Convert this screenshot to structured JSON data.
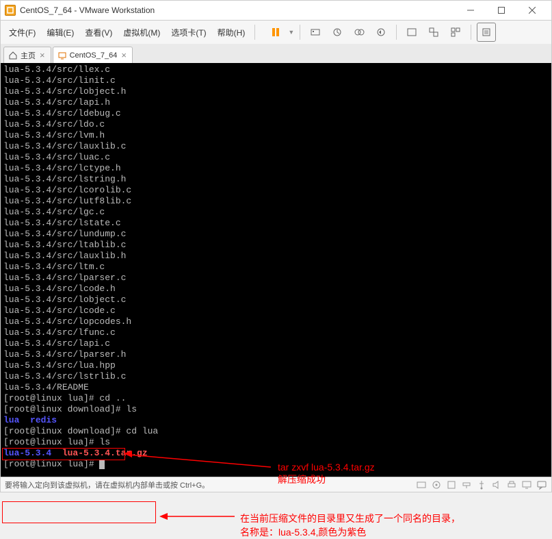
{
  "titlebar": {
    "title": "CentOS_7_64 - VMware Workstation"
  },
  "menubar": {
    "items": [
      "文件(F)",
      "编辑(E)",
      "查看(V)",
      "虚拟机(M)",
      "选项卡(T)",
      "帮助(H)"
    ]
  },
  "tabs": [
    {
      "label": "主页",
      "active": false
    },
    {
      "label": "CentOS_7_64",
      "active": true
    }
  ],
  "terminal": {
    "lines": [
      {
        "text": "lua-5.3.4/src/llex.c",
        "cls": "c-white"
      },
      {
        "text": "lua-5.3.4/src/linit.c",
        "cls": "c-white"
      },
      {
        "text": "lua-5.3.4/src/lobject.h",
        "cls": "c-white"
      },
      {
        "text": "lua-5.3.4/src/lapi.h",
        "cls": "c-white"
      },
      {
        "text": "lua-5.3.4/src/ldebug.c",
        "cls": "c-white"
      },
      {
        "text": "lua-5.3.4/src/ldo.c",
        "cls": "c-white"
      },
      {
        "text": "lua-5.3.4/src/lvm.h",
        "cls": "c-white"
      },
      {
        "text": "lua-5.3.4/src/lauxlib.c",
        "cls": "c-white"
      },
      {
        "text": "lua-5.3.4/src/luac.c",
        "cls": "c-white"
      },
      {
        "text": "lua-5.3.4/src/lctype.h",
        "cls": "c-white"
      },
      {
        "text": "lua-5.3.4/src/lstring.h",
        "cls": "c-white"
      },
      {
        "text": "lua-5.3.4/src/lcorolib.c",
        "cls": "c-white"
      },
      {
        "text": "lua-5.3.4/src/lutf8lib.c",
        "cls": "c-white"
      },
      {
        "text": "lua-5.3.4/src/lgc.c",
        "cls": "c-white"
      },
      {
        "text": "lua-5.3.4/src/lstate.c",
        "cls": "c-white"
      },
      {
        "text": "lua-5.3.4/src/lundump.c",
        "cls": "c-white"
      },
      {
        "text": "lua-5.3.4/src/ltablib.c",
        "cls": "c-white"
      },
      {
        "text": "lua-5.3.4/src/lauxlib.h",
        "cls": "c-white"
      },
      {
        "text": "lua-5.3.4/src/ltm.c",
        "cls": "c-white"
      },
      {
        "text": "lua-5.3.4/src/lparser.c",
        "cls": "c-white"
      },
      {
        "text": "lua-5.3.4/src/lcode.h",
        "cls": "c-white"
      },
      {
        "text": "lua-5.3.4/src/lobject.c",
        "cls": "c-white"
      },
      {
        "text": "lua-5.3.4/src/lcode.c",
        "cls": "c-white"
      },
      {
        "text": "lua-5.3.4/src/lopcodes.h",
        "cls": "c-white"
      },
      {
        "text": "lua-5.3.4/src/lfunc.c",
        "cls": "c-white"
      },
      {
        "text": "lua-5.3.4/src/lapi.c",
        "cls": "c-white"
      },
      {
        "text": "lua-5.3.4/src/lparser.h",
        "cls": "c-white"
      },
      {
        "text": "lua-5.3.4/src/lua.hpp",
        "cls": "c-white"
      },
      {
        "text": "lua-5.3.4/src/lstrlib.c",
        "cls": "c-white"
      },
      {
        "text": "lua-5.3.4/README",
        "cls": "c-white"
      }
    ],
    "prompt_lines": [
      {
        "prompt": "[root@linux lua]# ",
        "cmd": "cd .."
      },
      {
        "prompt": "[root@linux download]# ",
        "cmd": "ls"
      }
    ],
    "ls1": {
      "lua": "lua",
      "redis": "redis"
    },
    "prompt_cd": {
      "prompt": "[root@linux download]# ",
      "cmd": "cd lua"
    },
    "prompt_ls2": {
      "prompt": "[root@linux lua]# ",
      "cmd": "ls"
    },
    "ls2": {
      "dir": "lua-5.3.4",
      "tar": "lua-5.3.4.tar.gz"
    },
    "prompt_end": {
      "prompt": "[root@linux lua]# "
    }
  },
  "annotations": {
    "a1_line1": "tar zxvf lua-5.3.4.tar.gz",
    "a1_line2": "解压缩成功",
    "a2_line1": "在当前压缩文件的目录里又生成了一个同名的目录，",
    "a2_line2": "名称是：lua-5.3.4,颜色为紫色"
  },
  "statusbar": {
    "text": "要将输入定向到该虚拟机，请在虚拟机内部单击或按 Ctrl+G。"
  }
}
